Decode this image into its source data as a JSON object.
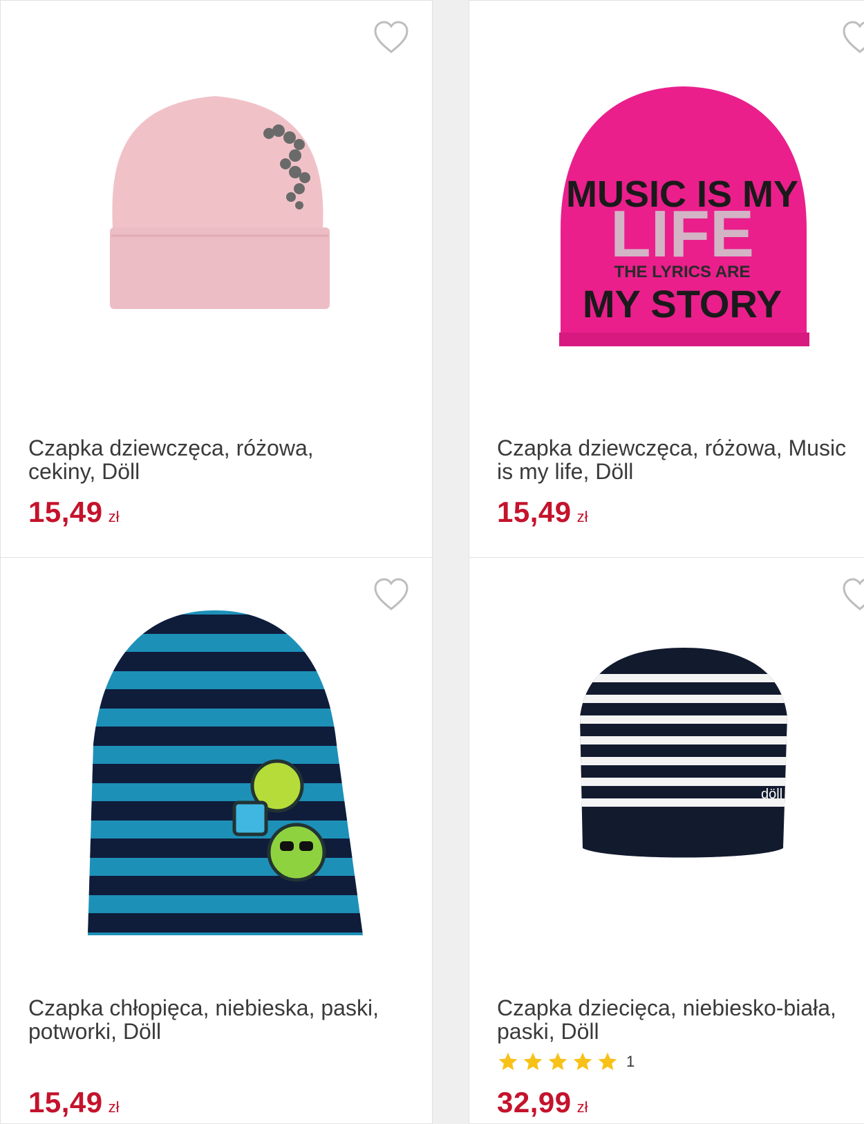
{
  "products": [
    {
      "title_line1": "Czapka dziewczęca, różowa,",
      "title_line2": "cekiny, Döll",
      "price": "15,49",
      "currency": "zł",
      "image": "pink-beanie-sequins"
    },
    {
      "title_line1": "Czapka dziewczęca, różowa, Music",
      "title_line2": "is my life, Döll",
      "price": "15,49",
      "currency": "zł",
      "image": "pink-beanie-music",
      "print_line1": "MUSIC IS MY",
      "print_line2": "LIFE",
      "print_line3": "THE LYRICS ARE",
      "print_line4": "MY STORY"
    },
    {
      "title_line1": "Czapka chłopięca, niebieska, paski,",
      "title_line2": "potworki, Döll",
      "price": "15,49",
      "currency": "zł",
      "image": "blue-striped-beanie-monsters"
    },
    {
      "title_line1": "Czapka dziecięca, niebiesko-biała,",
      "title_line2": "paski, Döll",
      "price": "32,99",
      "currency": "zł",
      "image": "navy-white-striped-beanie",
      "rating_value": 5,
      "rating_count": "1",
      "brand_tag": "döll"
    }
  ],
  "colors": {
    "price": "#c4132c",
    "star": "#f7c118",
    "heart_outline": "#bdbdbd"
  }
}
